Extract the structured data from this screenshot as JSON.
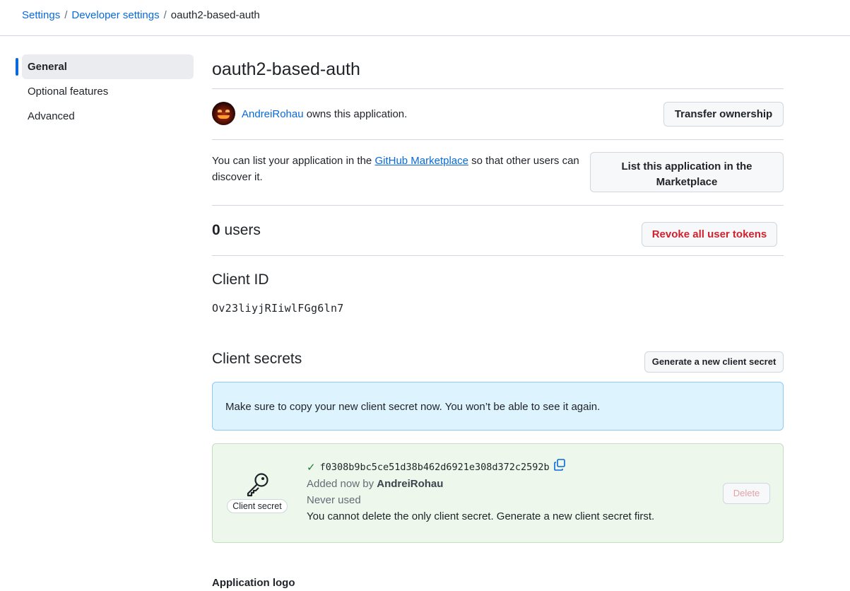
{
  "breadcrumb": {
    "items": [
      "Settings",
      "Developer settings"
    ],
    "current": "oauth2-based-auth",
    "separator": "/"
  },
  "sidebar": {
    "items": [
      {
        "label": "General",
        "active": true
      },
      {
        "label": "Optional features",
        "active": false
      },
      {
        "label": "Advanced",
        "active": false
      }
    ]
  },
  "app": {
    "title": "oauth2-based-auth",
    "owner": "AndreiRohau",
    "owner_suffix": "owns this application.",
    "transfer_button": "Transfer ownership",
    "marketplace_text_before": "You can list your application in the",
    "marketplace_link": "GitHub Marketplace",
    "marketplace_text_after": "so that other users can discover it.",
    "marketplace_button_line1": "List this application in the",
    "marketplace_button_line2": "Marketplace",
    "users_count": "0",
    "users_label": "users",
    "revoke_button": "Revoke all user tokens"
  },
  "client_id": {
    "heading": "Client ID",
    "value": "Ov23liyjRIiwlFGg6ln7"
  },
  "client_secrets": {
    "heading": "Client secrets",
    "generate_button": "Generate a new client secret",
    "flash_message": "Make sure to copy your new client secret now. You won’t be able to see it again.",
    "secret": {
      "label": "Client secret",
      "hash": "f0308b9bc5ce51d38b462d6921e308d372c2592b",
      "added_prefix": "Added now by",
      "added_by": "AndreiRohau",
      "usage": "Never used",
      "note": "You cannot delete the only client secret. Generate a new client secret first.",
      "delete_button": "Delete"
    }
  },
  "application_logo": {
    "heading": "Application logo"
  },
  "colors": {
    "link": "#0969da",
    "danger": "#cf222e",
    "success": "#1a7f37",
    "flash_bg": "#ddf4ff",
    "secret_bg": "#eef7ec"
  },
  "icons": {
    "check": "check-icon",
    "copy": "copy-icon",
    "key": "key-icon"
  }
}
